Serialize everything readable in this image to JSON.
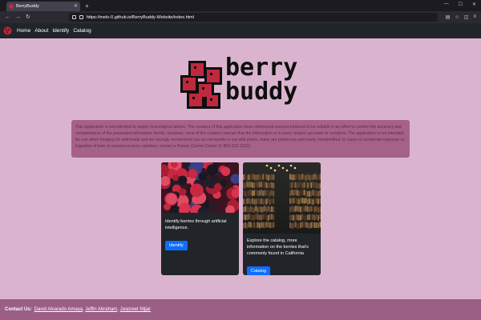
{
  "browser": {
    "tab_title": "BerryBuddy",
    "url": "https://melo-0.github.io/BerryBuddy-Website/index.html"
  },
  "nav": {
    "items": [
      {
        "label": "Home"
      },
      {
        "label": "About"
      },
      {
        "label": "Identify"
      },
      {
        "label": "Catalog"
      }
    ]
  },
  "logo": {
    "line1": "berry",
    "line2": "buddy"
  },
  "disclaimer": {
    "text": "This application is not intended to supply toxicological advice. The creators of this application have referenced sources believed to be reliable in an effort to confirm the accuracy and completeness of the presented information herein. However, none of the creators warrant that the information is in every respect accurate or complete. The application is not intended for use when foraging for wild foods and we strongly recommend you do not handle or eat wild plants, many are poisonous and easily misidentified. In cases of accidental exposure or ingestion of toxic or poisonous berry varieties, contact a Poison Control Center (1-800-222-1222)."
  },
  "cards": [
    {
      "text": "Identify berries through artificial intelligence.",
      "button": "Identify"
    },
    {
      "text": "Explore the catalog, more information on the berries that's commonly found in California",
      "button": "Catalog"
    }
  ],
  "footer": {
    "label": "Contact Us:",
    "contacts": [
      "David Alvarado Amaya",
      "Jeffin Abraham",
      "Jaspreet Nijjar"
    ]
  },
  "colors": {
    "page_bg": "#dab4cf",
    "disclaimer_bg": "#a66188",
    "footer_bg": "#9b5f86",
    "button": "#0d6efd",
    "card_bg": "#212529"
  }
}
